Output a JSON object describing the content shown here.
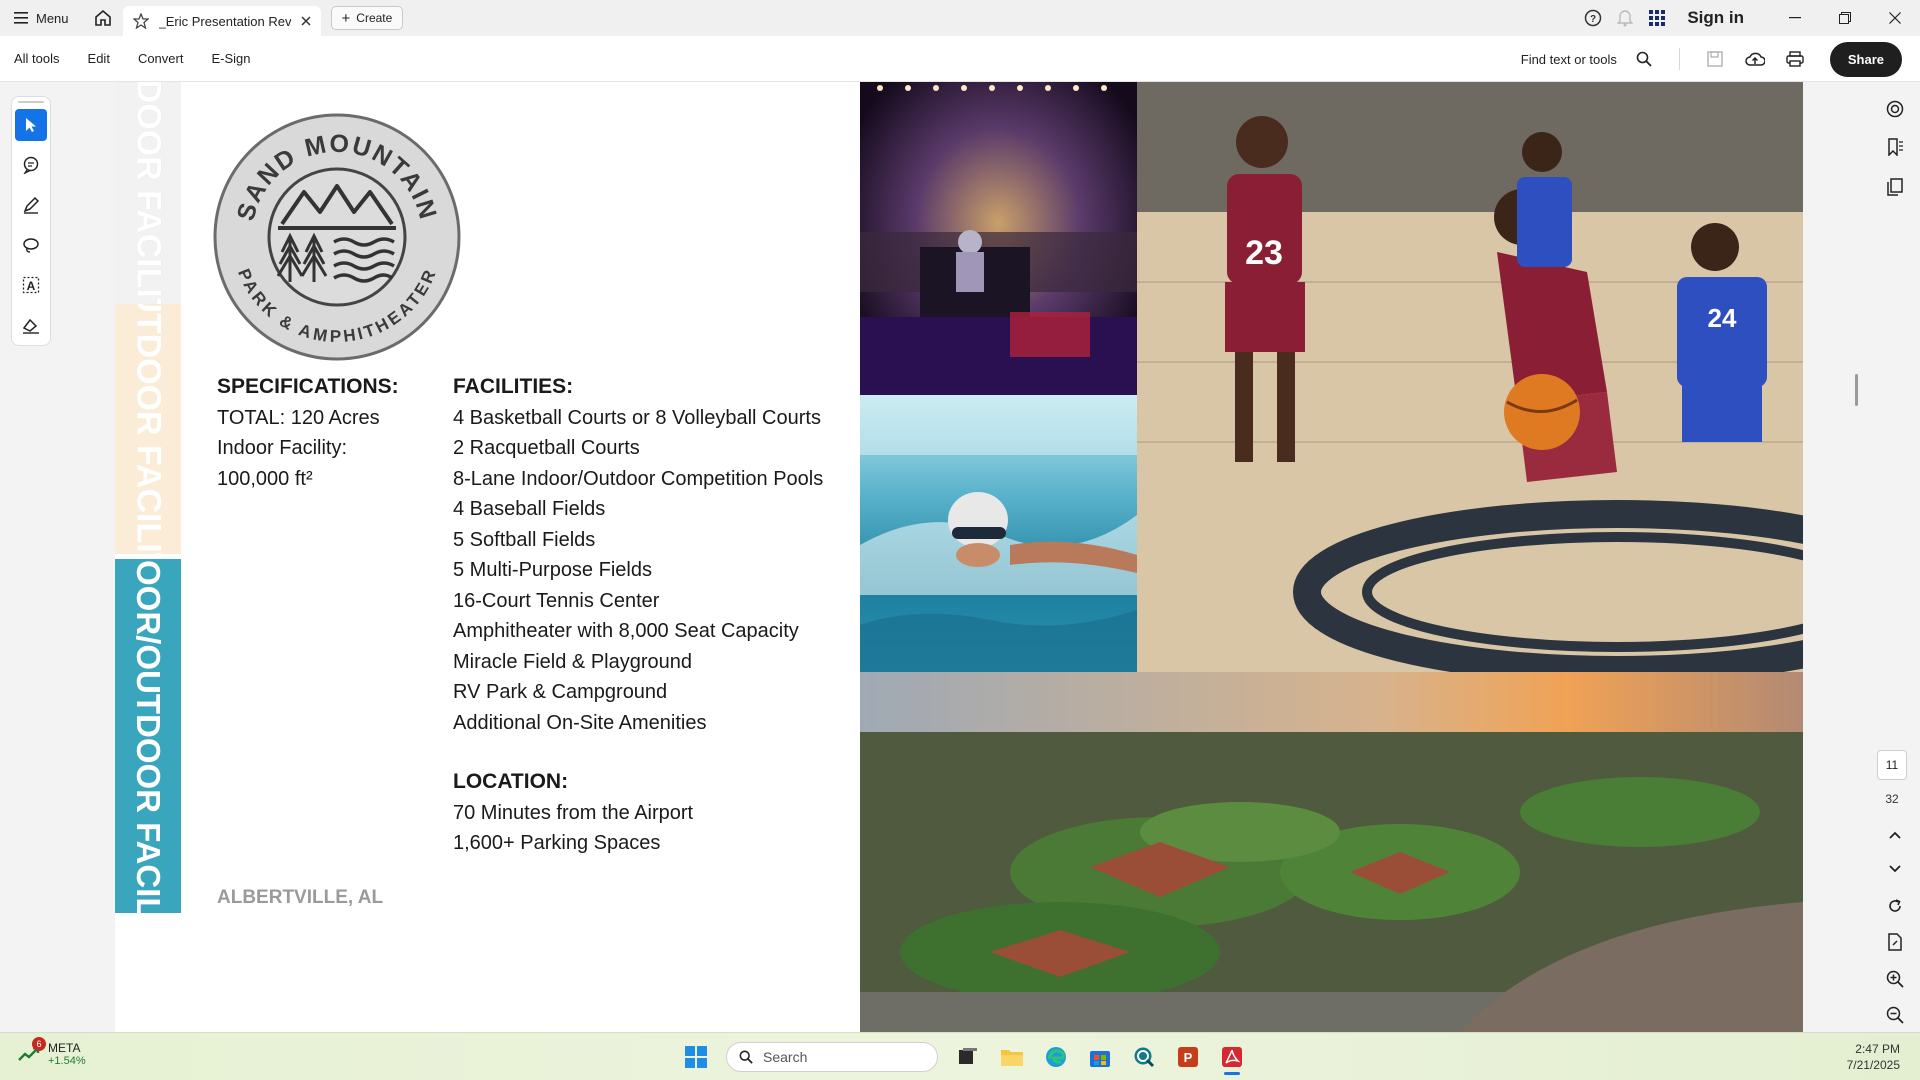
{
  "titlebar": {
    "menu_label": "Menu",
    "tab_title": "_Eric Presentation Revp...",
    "create_label": "Create",
    "sign_in_label": "Sign in"
  },
  "toolbar": {
    "menus": [
      "All tools",
      "Edit",
      "Convert",
      "E-Sign"
    ],
    "find_label": "Find text or tools",
    "share_label": "Share"
  },
  "left_tools": [
    "select-tool",
    "comment-tool",
    "highlight-tool",
    "draw-tool",
    "text-recognition-tool",
    "sign-tool"
  ],
  "document": {
    "stripe_labels": [
      "INDOOR FACILITY",
      "OUTDOOR FACILITY",
      "INDOOR/OUTDOOR FACILITY"
    ],
    "logo": {
      "top_text": "SAND MOUNTAIN",
      "bottom_text": "PARK & AMPHITHEATER"
    },
    "specifications": {
      "heading": "SPECIFICATIONS:",
      "lines": [
        "TOTAL: 120 Acres",
        "Indoor Facility:",
        "100,000 ft²"
      ]
    },
    "facilities": {
      "heading": "FACILITIES:",
      "items": [
        "4 Basketball Courts or 8 Volleyball Courts",
        "2 Racquetball Courts",
        "8-Lane Indoor/Outdoor Competition Pools",
        "4 Baseball Fields",
        "5 Softball Fields",
        "5 Multi-Purpose Fields",
        "16-Court Tennis Center",
        "Amphitheater with 8,000 Seat Capacity",
        "Miracle Field & Playground",
        "RV Park & Campground",
        "Additional On-Site Amenities"
      ]
    },
    "location": {
      "heading": "LOCATION:",
      "lines": [
        "70 Minutes from the Airport",
        "1,600+ Parking Spaces"
      ]
    },
    "city": "ALBERTVILLE, AL",
    "jersey_numbers": [
      "23",
      "24"
    ]
  },
  "page_nav": {
    "current_page": "11",
    "total_pages": "32"
  },
  "taskbar": {
    "stock_name": "META",
    "stock_change": "+1.54%",
    "notification_count": "6",
    "search_placeholder": "Search",
    "time": "2:47 PM",
    "date": "7/21/2025"
  },
  "colors": {
    "accent_blue": "#1473e6",
    "stripe_teal": "#3aa6bd",
    "stripe_cream": "#faecd6"
  }
}
